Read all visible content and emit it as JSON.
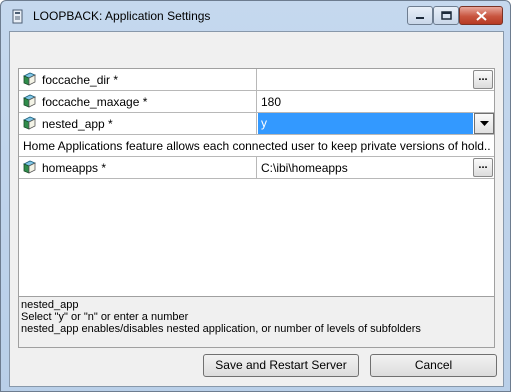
{
  "window": {
    "title": "LOOPBACK: Application Settings"
  },
  "titlebar_buttons": {
    "minimize_icon": "minimize-icon",
    "maximize_icon": "maximize-icon",
    "close_icon": "close-icon"
  },
  "settings": [
    {
      "name": "foccache_dir *",
      "value": "",
      "control": "ellipsis",
      "icon": "book-icon"
    },
    {
      "name": "foccache_maxage *",
      "value": "180",
      "control": "none",
      "icon": "book-icon"
    },
    {
      "name": "nested_app *",
      "value": "y",
      "control": "dropdown",
      "icon": "book-icon",
      "selected": true
    }
  ],
  "description_row": "Home Applications feature allows each connected user to keep private versions of hold...",
  "settings_after": [
    {
      "name": "homeapps *",
      "value": "C:\\ibi\\homeapps",
      "control": "ellipsis",
      "icon": "book-icon"
    }
  ],
  "ellipsis_label": "...",
  "help": {
    "line1": "nested_app",
    "line2": "Select \"y\" or \"n\" or enter a number",
    "line3": "nested_app enables/disables nested application, or number of levels of subfolders"
  },
  "buttons": {
    "save_label": "Save and Restart Server",
    "cancel_label": "Cancel"
  },
  "colors": {
    "selection": "#3399ff",
    "close_button": "#c8553f"
  }
}
